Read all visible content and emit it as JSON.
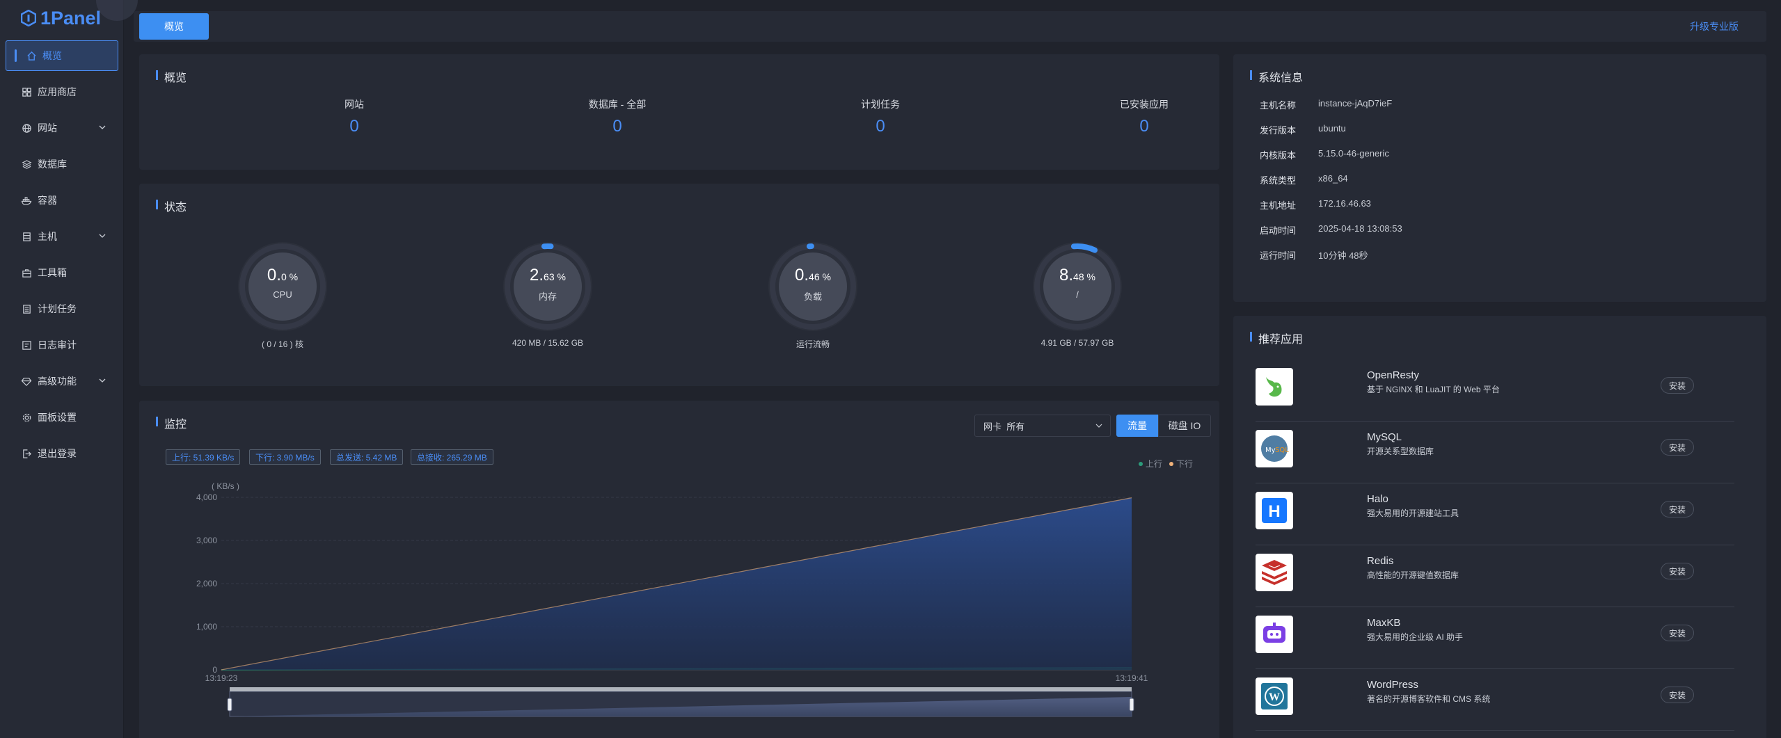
{
  "sidebar": {
    "logo": "1Panel",
    "items": [
      {
        "label": "概览",
        "active": true
      },
      {
        "label": "应用商店"
      },
      {
        "label": "网站",
        "expandable": true
      },
      {
        "label": "数据库"
      },
      {
        "label": "容器"
      },
      {
        "label": "主机",
        "expandable": true
      },
      {
        "label": "工具箱"
      },
      {
        "label": "计划任务"
      },
      {
        "label": "日志审计"
      },
      {
        "label": "高级功能",
        "expandable": true
      },
      {
        "label": "面板设置"
      },
      {
        "label": "退出登录"
      }
    ]
  },
  "topbar": {
    "tab": "概览",
    "upgrade": "升级专业版"
  },
  "overview": {
    "title": "概览",
    "items": [
      {
        "label": "网站",
        "value": "0"
      },
      {
        "label": "数据库 - 全部",
        "value": "0"
      },
      {
        "label": "计划任务",
        "value": "0"
      },
      {
        "label": "已安装应用",
        "value": "0"
      }
    ]
  },
  "status": {
    "title": "状态",
    "gauges": [
      {
        "int": "0.",
        "dec": "0 %",
        "name": "CPU",
        "sub": "( 0 / 16 ) 核",
        "percent": 0.0
      },
      {
        "int": "2.",
        "dec": "63 %",
        "name": "内存",
        "sub": "420 MB / 15.62 GB",
        "percent": 2.63
      },
      {
        "int": "0.",
        "dec": "46 %",
        "name": "负载",
        "sub": "运行流畅",
        "percent": 0.46
      },
      {
        "int": "8.",
        "dec": "48 %",
        "name": "/",
        "sub": "4.91 GB / 57.97 GB",
        "percent": 8.48
      }
    ]
  },
  "monitor": {
    "title": "监控",
    "nic_select": "网卡  所有",
    "btn_flow": "流量",
    "btn_io": "磁盘 IO",
    "tags": [
      "上行: 51.39 KB/s",
      "下行: 3.90 MB/s",
      "总发送: 5.42 MB",
      "总接收: 265.29 MB"
    ],
    "legend": {
      "up": "上行",
      "down": "下行",
      "up_color": "#2c9c7b",
      "down_color": "#f0b27a"
    }
  },
  "chart_data": {
    "type": "area",
    "ylabel": "( KB/s )",
    "x": [
      "13:19:23",
      "13:19:41"
    ],
    "yticks": [
      0,
      1000,
      2000,
      3000,
      4000
    ],
    "ytick_labels": [
      "0",
      "1,000",
      "2,000",
      "3,000",
      "4,000"
    ],
    "ylim": [
      0,
      4000
    ],
    "series": [
      {
        "name": "上行",
        "values": [
          0,
          51.39
        ]
      },
      {
        "name": "下行",
        "values": [
          0,
          3990
        ]
      }
    ]
  },
  "sysinfo": {
    "title": "系统信息",
    "rows": [
      {
        "key": "主机名称",
        "val": "instance-jAqD7ieF"
      },
      {
        "key": "发行版本",
        "val": "ubuntu"
      },
      {
        "key": "内核版本",
        "val": "5.15.0-46-generic"
      },
      {
        "key": "系统类型",
        "val": "x86_64"
      },
      {
        "key": "主机地址",
        "val": "172.16.46.63"
      },
      {
        "key": "启动时间",
        "val": "2025-04-18 13:08:53"
      },
      {
        "key": "运行时间",
        "val": "10分钟 48秒"
      }
    ]
  },
  "apps": {
    "title": "推荐应用",
    "install_label": "安装",
    "items": [
      {
        "name": "OpenResty",
        "desc": "基于 NGINX 和 LuaJIT 的 Web 平台",
        "icon": "openresty-icon"
      },
      {
        "name": "MySQL",
        "desc": "开源关系型数据库",
        "icon": "mysql-icon"
      },
      {
        "name": "Halo",
        "desc": "强大易用的开源建站工具",
        "icon": "halo-icon"
      },
      {
        "name": "Redis",
        "desc": "高性能的开源键值数据库",
        "icon": "redis-icon"
      },
      {
        "name": "MaxKB",
        "desc": "强大易用的企业级 AI 助手",
        "icon": "maxkb-icon"
      },
      {
        "name": "WordPress",
        "desc": "著名的开源博客软件和 CMS 系统",
        "icon": "wordpress-icon"
      }
    ]
  }
}
